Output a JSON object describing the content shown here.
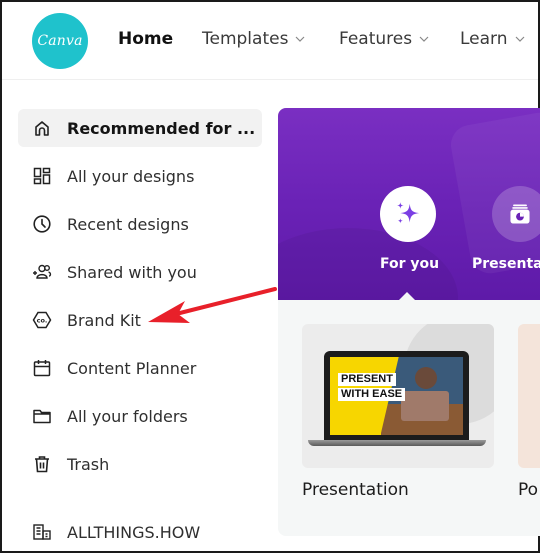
{
  "header": {
    "logo_text": "Canva",
    "nav": [
      {
        "label": "Home",
        "has_dropdown": false,
        "active": true
      },
      {
        "label": "Templates",
        "has_dropdown": true
      },
      {
        "label": "Features",
        "has_dropdown": true
      },
      {
        "label": "Learn",
        "has_dropdown": true
      }
    ]
  },
  "sidebar": {
    "items": [
      {
        "label": "Recommended for ...",
        "icon": "home-icon",
        "active": true
      },
      {
        "label": "All your designs",
        "icon": "grid-icon"
      },
      {
        "label": "Recent designs",
        "icon": "clock-icon"
      },
      {
        "label": "Shared with you",
        "icon": "shared-users-icon"
      },
      {
        "label": "Brand Kit",
        "icon": "brand-kit-icon"
      },
      {
        "label": "Content Planner",
        "icon": "calendar-icon"
      },
      {
        "label": "All your folders",
        "icon": "folder-icon"
      },
      {
        "label": "Trash",
        "icon": "trash-icon"
      }
    ],
    "team": {
      "label": "ALLTHINGS.HOW",
      "icon": "building-icon"
    }
  },
  "main": {
    "categories": [
      {
        "label": "For you",
        "icon": "sparkle-icon",
        "active": true
      },
      {
        "label": "Presentat",
        "icon": "presentation-icon"
      }
    ],
    "templates": [
      {
        "label": "Presentation",
        "thumb_text": [
          "PRESENT",
          "WITH EASE"
        ]
      },
      {
        "label": "Po"
      }
    ]
  },
  "annotation": {
    "type": "arrow",
    "color": "#e8202a",
    "target": "Brand Kit"
  },
  "colors": {
    "brand": "#1fc2cc",
    "hero_purple": "#6a22b6",
    "active_bg": "#f2f2f2"
  }
}
